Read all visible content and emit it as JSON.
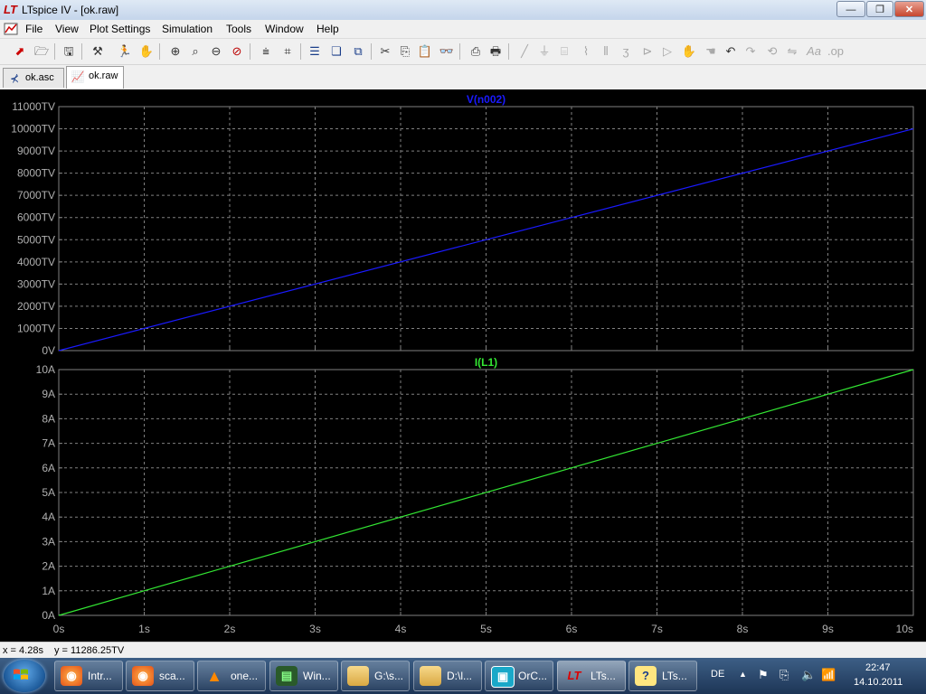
{
  "window": {
    "title": "LTspice IV - [ok.raw]",
    "app_icon": "LT",
    "buttons": {
      "minimize": "—",
      "maximize": "❐",
      "close": "✕"
    }
  },
  "menu": {
    "items": [
      "File",
      "View",
      "Plot Settings",
      "Simulation",
      "Tools",
      "Window",
      "Help"
    ],
    "mdi_buttons": {
      "minimize": "–",
      "restore": "❐",
      "close": "✕"
    }
  },
  "tabs": [
    {
      "label": "ok.asc",
      "icon": "schematic-icon"
    },
    {
      "label": "ok.raw",
      "icon": "waveform-icon"
    }
  ],
  "plot": {
    "background": "#000000",
    "grid_color": "#808080",
    "tick_color": "#b0b0b0",
    "panes": [
      {
        "trace_label": "V(n002)",
        "trace_color": "#1a1aff",
        "y_ticks": [
          "0V",
          "1000TV",
          "2000TV",
          "3000TV",
          "4000TV",
          "5000TV",
          "6000TV",
          "7000TV",
          "8000TV",
          "9000TV",
          "10000TV",
          "11000TV"
        ]
      },
      {
        "trace_label": "I(L1)",
        "trace_color": "#33e633",
        "y_ticks": [
          "0A",
          "1A",
          "2A",
          "3A",
          "4A",
          "5A",
          "6A",
          "7A",
          "8A",
          "9A",
          "10A"
        ]
      }
    ],
    "x_ticks": [
      "0s",
      "1s",
      "2s",
      "3s",
      "4s",
      "5s",
      "6s",
      "7s",
      "8s",
      "9s",
      "10s"
    ]
  },
  "chart_data": [
    {
      "type": "line",
      "title": "V(n002)",
      "xlabel": "",
      "ylabel": "",
      "x": [
        0,
        10
      ],
      "series": [
        {
          "name": "V(n002)",
          "values": [
            0,
            10000
          ]
        }
      ],
      "xlim": [
        0,
        10
      ],
      "ylim": [
        0,
        11000
      ],
      "grid": true
    },
    {
      "type": "line",
      "title": "I(L1)",
      "xlabel": "",
      "ylabel": "",
      "x": [
        0,
        10
      ],
      "series": [
        {
          "name": "I(L1)",
          "values": [
            0,
            10
          ]
        }
      ],
      "xlim": [
        0,
        10
      ],
      "ylim": [
        0,
        10
      ],
      "grid": true
    }
  ],
  "status": {
    "x_readout": "x = 4.28s",
    "y_readout": "y = 11286.25TV"
  },
  "taskbar": {
    "items": [
      {
        "label": "Intr...",
        "icon": "firefox-icon"
      },
      {
        "label": "sca...",
        "icon": "firefox-icon"
      },
      {
        "label": "one...",
        "icon": "vlc-icon"
      },
      {
        "label": "Win...",
        "icon": "monitor-icon"
      },
      {
        "label": "G:\\s...",
        "icon": "folder-icon"
      },
      {
        "label": "D:\\l...",
        "icon": "folder-icon"
      },
      {
        "label": "OrC...",
        "icon": "chip-icon"
      },
      {
        "label": "LTs...",
        "icon": "ltspice-icon"
      },
      {
        "label": "LTs...",
        "icon": "help-icon"
      }
    ],
    "language": "DE",
    "time": "22:47",
    "date": "14.10.2011"
  }
}
